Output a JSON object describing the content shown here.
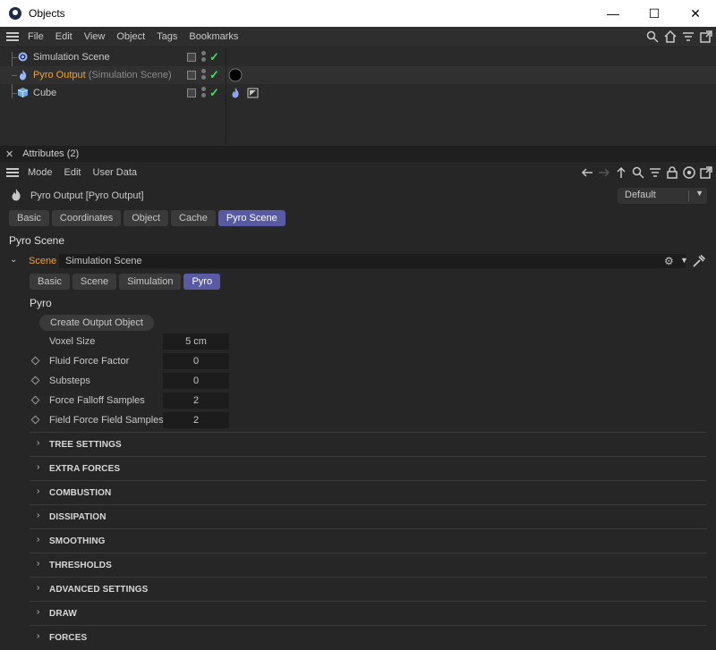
{
  "window": {
    "title": "Objects",
    "minimize": "—",
    "maximize": "☐",
    "close": "✕"
  },
  "object_manager": {
    "menu": [
      "File",
      "Edit",
      "View",
      "Object",
      "Tags",
      "Bookmarks"
    ],
    "objects": [
      {
        "name": "Simulation Scene",
        "sub": "",
        "icon": "simulation-scene-icon"
      },
      {
        "name": "Pyro Output",
        "sub": "(Simulation Scene)",
        "icon": "pyro-fire-icon"
      },
      {
        "name": "Cube",
        "sub": "",
        "icon": "cube-icon"
      }
    ]
  },
  "attributes": {
    "title": "Attributes (2)",
    "menu": [
      "Mode",
      "Edit",
      "User Data"
    ],
    "object_name": "Pyro Output [Pyro Output]",
    "mode_dropdown": "Default",
    "tabs": [
      "Basic",
      "Coordinates",
      "Object",
      "Cache",
      "Pyro Scene"
    ],
    "active_tab": "Pyro Scene",
    "section_title": "Pyro Scene",
    "scene_label": "Scene",
    "scene_value": "Simulation Scene",
    "sub_tabs": [
      "Basic",
      "Scene",
      "Simulation",
      "Pyro"
    ],
    "active_sub_tab": "Pyro",
    "sub_section_title": "Pyro",
    "create_button": "Create Output Object",
    "params": [
      {
        "label": "Voxel Size",
        "value": "5 cm",
        "keyframe": false
      },
      {
        "label": "Fluid Force Factor",
        "value": "0",
        "keyframe": true
      },
      {
        "label": "Substeps",
        "value": "0",
        "keyframe": true
      },
      {
        "label": "Force Falloff Samples",
        "value": "2",
        "keyframe": true
      },
      {
        "label": "Field Force Field Samples",
        "value": "2",
        "keyframe": true
      }
    ],
    "groups": [
      "TREE SETTINGS",
      "EXTRA FORCES",
      "COMBUSTION",
      "DISSIPATION",
      "SMOOTHING",
      "THRESHOLDS",
      "ADVANCED SETTINGS",
      "DRAW",
      "FORCES"
    ]
  },
  "colors": {
    "accent": "#585aa4",
    "selected_text": "#f0a030",
    "check_green": "#4cd964"
  }
}
